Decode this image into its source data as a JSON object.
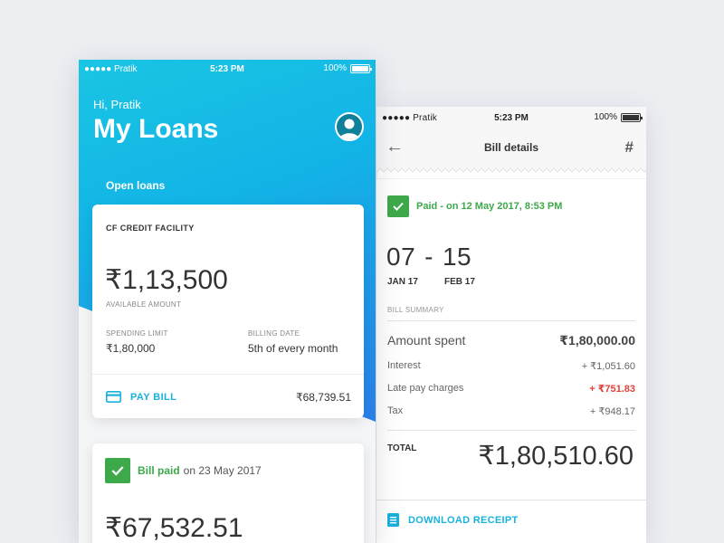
{
  "loans_screen": {
    "status": {
      "carrier": "●●●●● Pratik",
      "time": "5:23 PM",
      "battery": "100%"
    },
    "greeting": "Hi, Pratik",
    "title": "My Loans",
    "section_label": "Open loans",
    "credit_card": {
      "heading": "CF CREDIT FACILITY",
      "amount": "₹1,13,500",
      "amount_label": "AVAILABLE AMOUNT",
      "spending_limit_label": "SPENDING LIMIT",
      "spending_limit_value": "₹1,80,000",
      "billing_date_label": "BILLING DATE",
      "billing_date_value": "5th of every month",
      "pay_bill_label": "PAY BILL",
      "due_amount": "₹68,739.51"
    },
    "paid_card": {
      "paid_label": "Bill paid",
      "paid_date": "on 23 May 2017",
      "amount": "₹67,532.51"
    }
  },
  "bill_screen": {
    "status": {
      "carrier": "●●●●● Pratik",
      "time": "5:23 PM",
      "battery": "100%"
    },
    "nav_title": "Bill details",
    "back_symbol": "←",
    "hash_symbol": "#",
    "paid_status": "Paid - on 12 May 2017, 8:53 PM",
    "range_start": "07",
    "range_sep": "-",
    "range_end": "15",
    "start_month": "JAN 17",
    "end_month": "FEB 17",
    "summary_label": "BILL SUMMARY",
    "lines": [
      {
        "label": "Amount spent",
        "value": "₹1,80,000.00"
      },
      {
        "label": "Interest",
        "value": "+ ₹1,051.60"
      },
      {
        "label": "Late pay charges",
        "value": "+ ₹751.83"
      },
      {
        "label": "Tax",
        "value": "+ ₹948.17"
      }
    ],
    "total_label": "TOTAL",
    "total_value": "₹1,80,510.60",
    "download_label": "DOWNLOAD RECEIPT"
  },
  "colors": {
    "accent": "#18b2dd",
    "paid_green": "#3ea94a",
    "late_red": "#e0413a",
    "hero_gradient": [
      "#1ac5e3",
      "#2a7fe8"
    ]
  },
  "icons": [
    "wifi-icon",
    "battery-icon",
    "avatar-icon",
    "card-icon",
    "check-icon",
    "back-arrow-icon",
    "hash-icon",
    "document-icon"
  ]
}
